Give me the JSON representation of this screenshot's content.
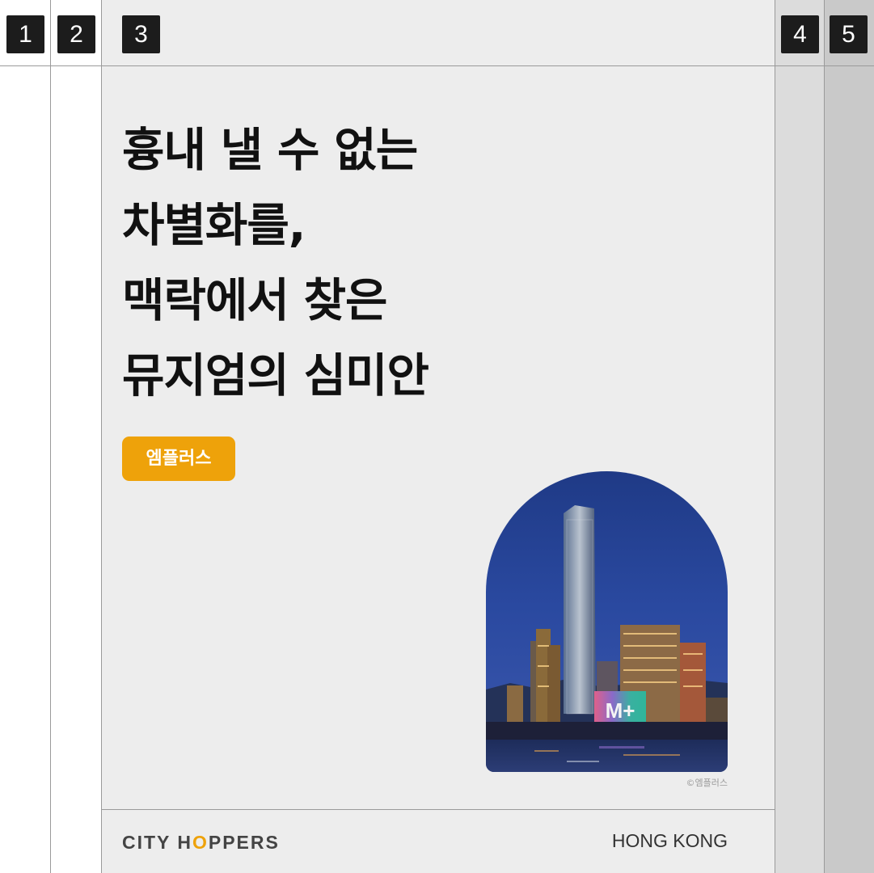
{
  "tabs": [
    "1",
    "2",
    "3",
    "4",
    "5"
  ],
  "headline": {
    "lines": [
      "흉내 낼 수 없는",
      "차별화를,",
      "맥락에서 찾은",
      "뮤지엄의 심미안"
    ]
  },
  "badge": {
    "label": "엠플러스",
    "color": "#eea20a"
  },
  "photo": {
    "sign_text": "M+",
    "credit": "©엠플러스"
  },
  "footer": {
    "brand_prefix": "CITY H",
    "brand_accent": "O",
    "brand_suffix": "PPERS",
    "location": "HONG KONG"
  },
  "colors": {
    "accent": "#eea20a",
    "panel": "#ededed",
    "tab_bg": "#1c1c1c"
  }
}
